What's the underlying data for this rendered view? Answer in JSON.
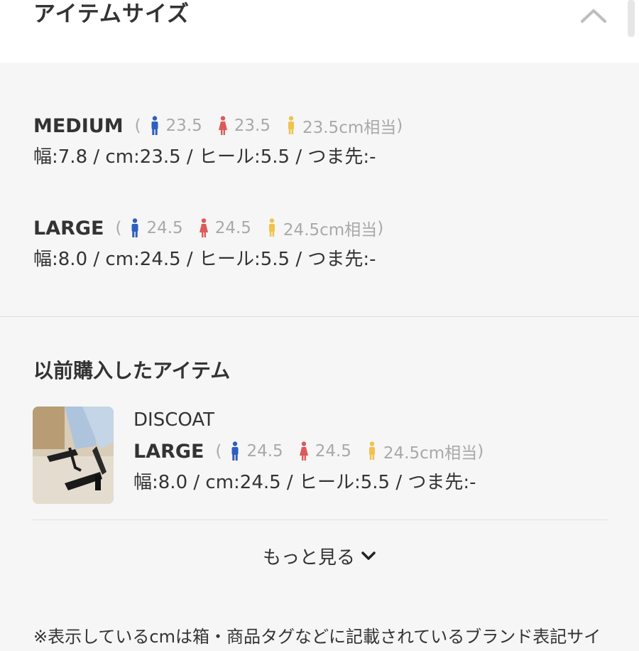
{
  "header": {
    "title": "アイテムサイズ"
  },
  "sizes": [
    {
      "name": "MEDIUM",
      "paren_open": "(",
      "men": "23.5",
      "women": "23.5",
      "general": "23.5cm相当",
      "paren_close": ")",
      "spec": "幅:7.8 / cm:23.5 / ヒール:5.5 / つま先:-"
    },
    {
      "name": "LARGE",
      "paren_open": "(",
      "men": "24.5",
      "women": "24.5",
      "general": "24.5cm相当",
      "paren_close": ")",
      "spec": "幅:8.0 / cm:24.5 / ヒール:5.5 / つま先:-"
    }
  ],
  "previous": {
    "title": "以前購入したアイテム",
    "brand": "DISCOAT",
    "size": "LARGE",
    "paren_open": "(",
    "men": "24.5",
    "women": "24.5",
    "general": "24.5cm相当",
    "paren_close": ")",
    "spec": "幅:8.0 / cm:24.5 / ヒール:5.5 / つま先:-"
  },
  "more": {
    "label": "もっと見る"
  },
  "footnote": "※表示しているcmは箱・商品タグなどに記載されているブランド表記サイ",
  "colors": {
    "men": "#2d5fbe",
    "women": "#dd5a5a",
    "general": "#f0c24e"
  },
  "icons": [
    "chevron-up-icon",
    "man-icon",
    "woman-icon",
    "person-icon",
    "chevron-down-icon"
  ]
}
